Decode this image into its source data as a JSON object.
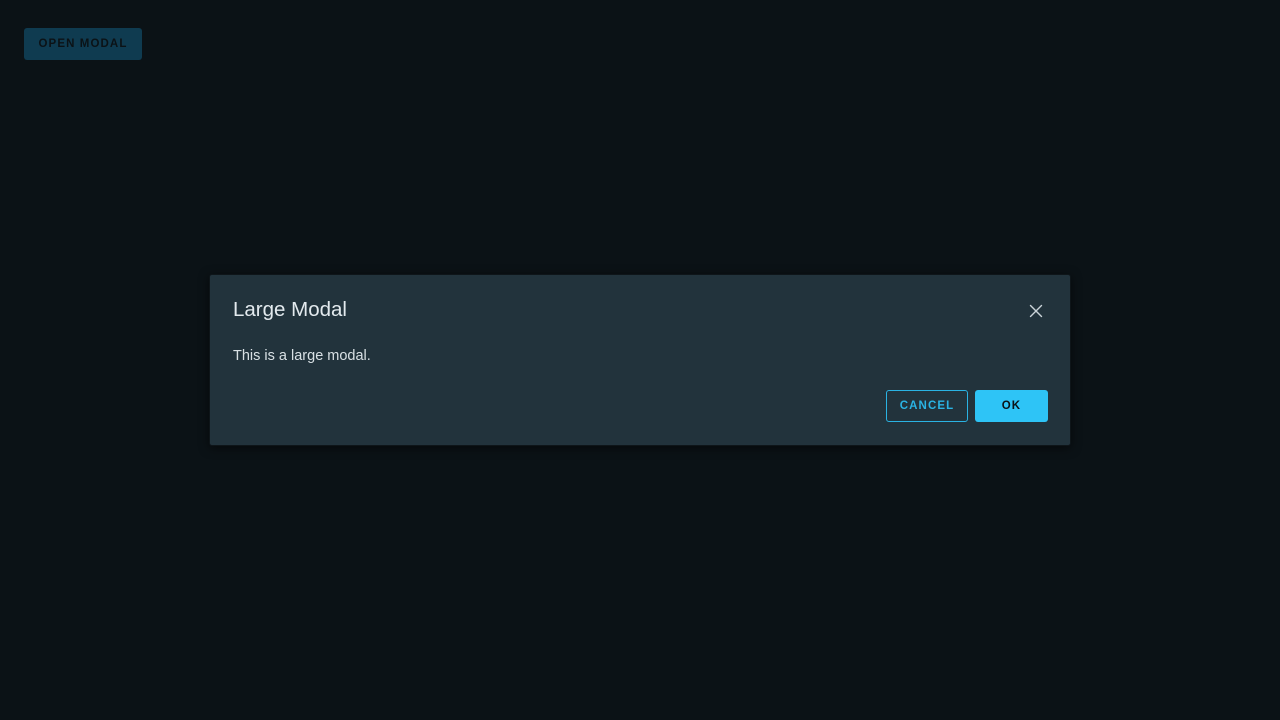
{
  "page": {
    "open_modal_label": "OPEN MODAL"
  },
  "modal": {
    "title": "Large Modal",
    "body": "This is a large modal.",
    "close_icon": "close-icon",
    "cancel_label": "CANCEL",
    "ok_label": "OK"
  },
  "colors": {
    "background": "#0b1216",
    "modal_background": "#22333c",
    "accent": "#2ec4f6",
    "open_modal_button": "#0f3b50"
  }
}
